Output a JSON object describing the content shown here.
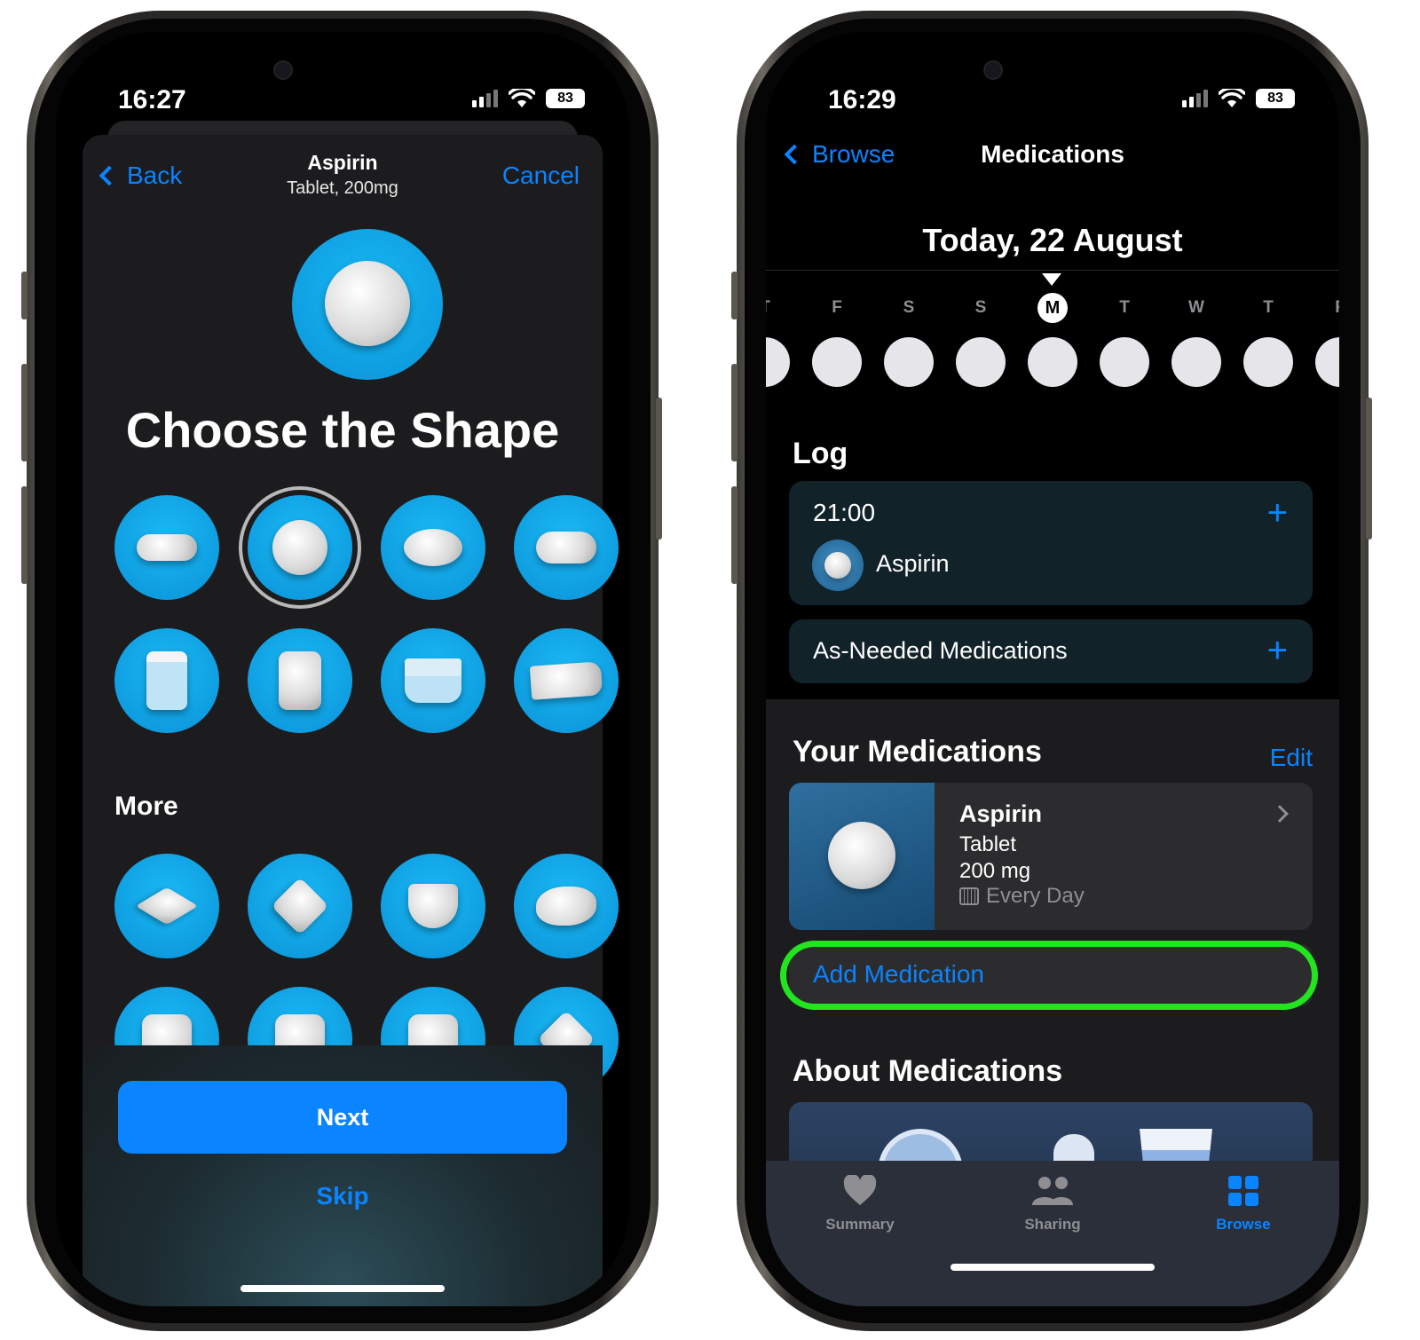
{
  "left_phone": {
    "status": {
      "time": "16:27",
      "battery": "83"
    },
    "nav": {
      "back_label": "Back",
      "title": "Aspirin",
      "subtitle": "Tablet, 200mg",
      "cancel_label": "Cancel"
    },
    "heading": "Choose the Shape",
    "shapes": [
      "capsule",
      "round",
      "oval",
      "oblong",
      "jar",
      "bottle",
      "cup",
      "tube"
    ],
    "selected_shape_index": 1,
    "more_label": "More",
    "more_shapes": [
      "diamond-flat",
      "diamond",
      "triangle",
      "egg",
      "square",
      "square",
      "pentagon",
      "diamond-rounded"
    ],
    "next_label": "Next",
    "skip_label": "Skip"
  },
  "right_phone": {
    "status": {
      "time": "16:29",
      "battery": "83"
    },
    "nav": {
      "back_label": "Browse",
      "title": "Medications"
    },
    "date_title": "Today, 22 August",
    "week_days": [
      "T",
      "F",
      "S",
      "S",
      "M",
      "T",
      "W",
      "T",
      "F"
    ],
    "today_index": 4,
    "log": {
      "heading": "Log",
      "time": "21:00",
      "medication": "Aspirin",
      "as_needed_label": "As-Needed Medications"
    },
    "your_medications": {
      "heading": "Your Medications",
      "edit_label": "Edit",
      "item": {
        "name": "Aspirin",
        "form": "Tablet",
        "dose": "200 mg",
        "schedule": "Every Day"
      },
      "add_label": "Add Medication",
      "highlight_color": "#22e51f"
    },
    "about_heading": "About Medications",
    "tabs": [
      {
        "label": "Summary",
        "icon": "heart-icon"
      },
      {
        "label": "Sharing",
        "icon": "people-icon"
      },
      {
        "label": "Browse",
        "icon": "grid-icon"
      }
    ],
    "active_tab": "Browse"
  },
  "colors": {
    "accent": "#0a84ff",
    "shape_bg": "#0a93d8",
    "card_bg": "#122229"
  }
}
